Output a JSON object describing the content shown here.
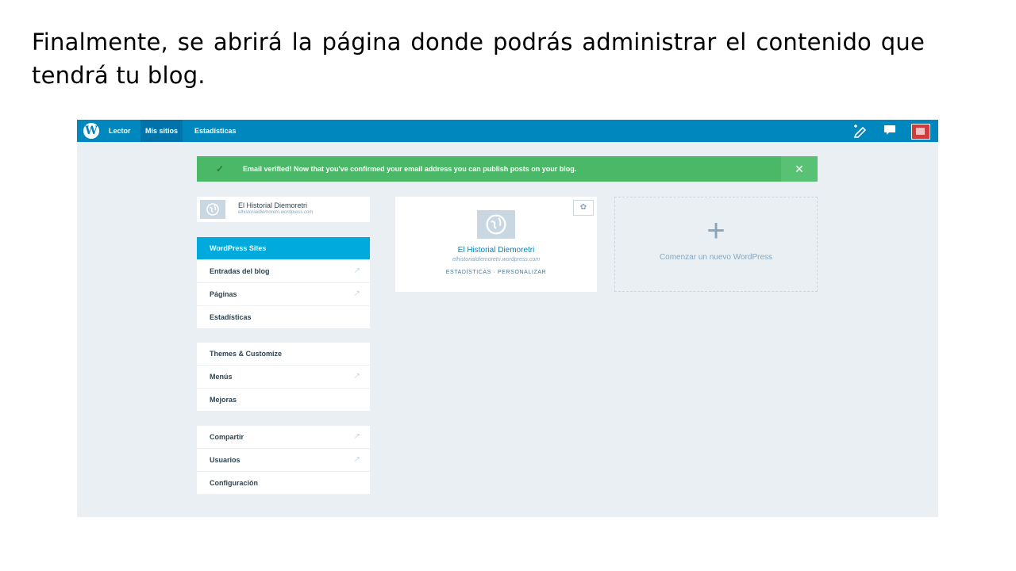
{
  "caption": "Finalmente, se abrirá la página donde podrás administrar el contenido que tendrá tu blog.",
  "topbar": {
    "logo": "W",
    "nav": [
      {
        "label": "Lector"
      },
      {
        "label": "Mis sitios"
      },
      {
        "label": "Estadísticas"
      }
    ],
    "icons": [
      "new-post-icon",
      "notifications-icon",
      "avatar"
    ]
  },
  "notice": {
    "check": "✓",
    "message": "Email verified! Now that you've confirmed your email address you can publish posts on your blog.",
    "close": "✕"
  },
  "site_selector": {
    "name": "El Historial Diemoretri",
    "url": "elhistorialdiemoretri.wordpress.com"
  },
  "sidebar": {
    "group1": [
      {
        "label": "WordPress Sites",
        "external": ""
      },
      {
        "label": "Entradas del blog",
        "external": "↗"
      },
      {
        "label": "Páginas",
        "external": "↗"
      },
      {
        "label": "Estadísticas",
        "external": ""
      }
    ],
    "group2": [
      {
        "label": "Themes & Customize",
        "external": ""
      },
      {
        "label": "Menús",
        "external": "↗"
      },
      {
        "label": "Mejoras",
        "external": ""
      }
    ],
    "group3": [
      {
        "label": "Compartir",
        "external": "↗"
      },
      {
        "label": "Usuarios",
        "external": "↗"
      },
      {
        "label": "Configuración",
        "external": ""
      }
    ]
  },
  "site_card": {
    "gear": "✿",
    "title": "El Historial Diemoretri",
    "url": "elhistorialdiemoretri.wordpress.com",
    "actions": "ESTADÍSTICAS · PERSONALIZAR"
  },
  "new_site": {
    "plus": "+",
    "label": "Comenzar un nuevo WordPress"
  },
  "colors": {
    "topbar": "#0087be",
    "notice": "#4ab866",
    "selected": "#00aadc",
    "background": "#e9eff3"
  }
}
